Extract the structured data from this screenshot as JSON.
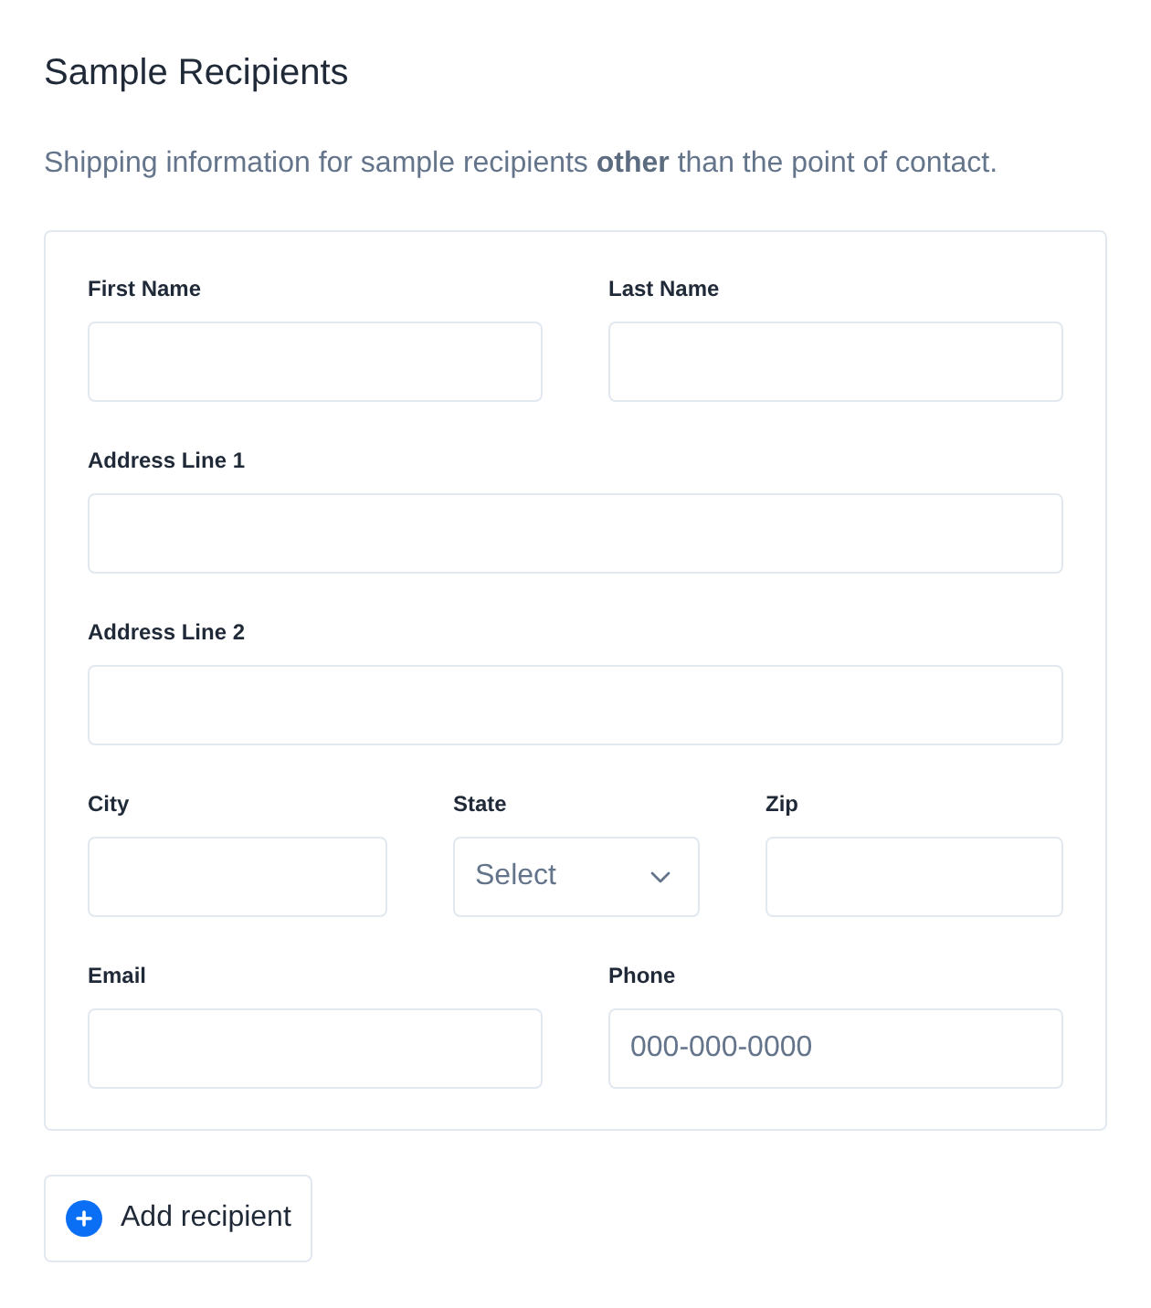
{
  "section": {
    "title": "Sample Recipients",
    "description": "Shipping information for sample recipients **other** than the point of contact."
  },
  "form": {
    "rows": [
      {
        "fields": [
          {
            "label": "First Name",
            "kind": "text"
          },
          {
            "label": "Last Name",
            "kind": "text"
          }
        ]
      },
      {
        "fields": [
          {
            "label": "Address Line 1",
            "kind": "text"
          }
        ]
      },
      {
        "fields": [
          {
            "label": "Address Line 2",
            "kind": "text"
          }
        ]
      },
      {
        "fields": [
          {
            "label": "City",
            "kind": "text"
          },
          {
            "label": "State",
            "kind": "select",
            "placeholder": "Select"
          },
          {
            "label": "Zip",
            "kind": "text"
          }
        ]
      },
      {
        "fields": [
          {
            "label": "Email",
            "kind": "text"
          },
          {
            "label": "Phone",
            "kind": "text",
            "placeholder": "000-000-0000"
          }
        ]
      }
    ]
  },
  "add_button": {
    "label": "Add recipient"
  }
}
